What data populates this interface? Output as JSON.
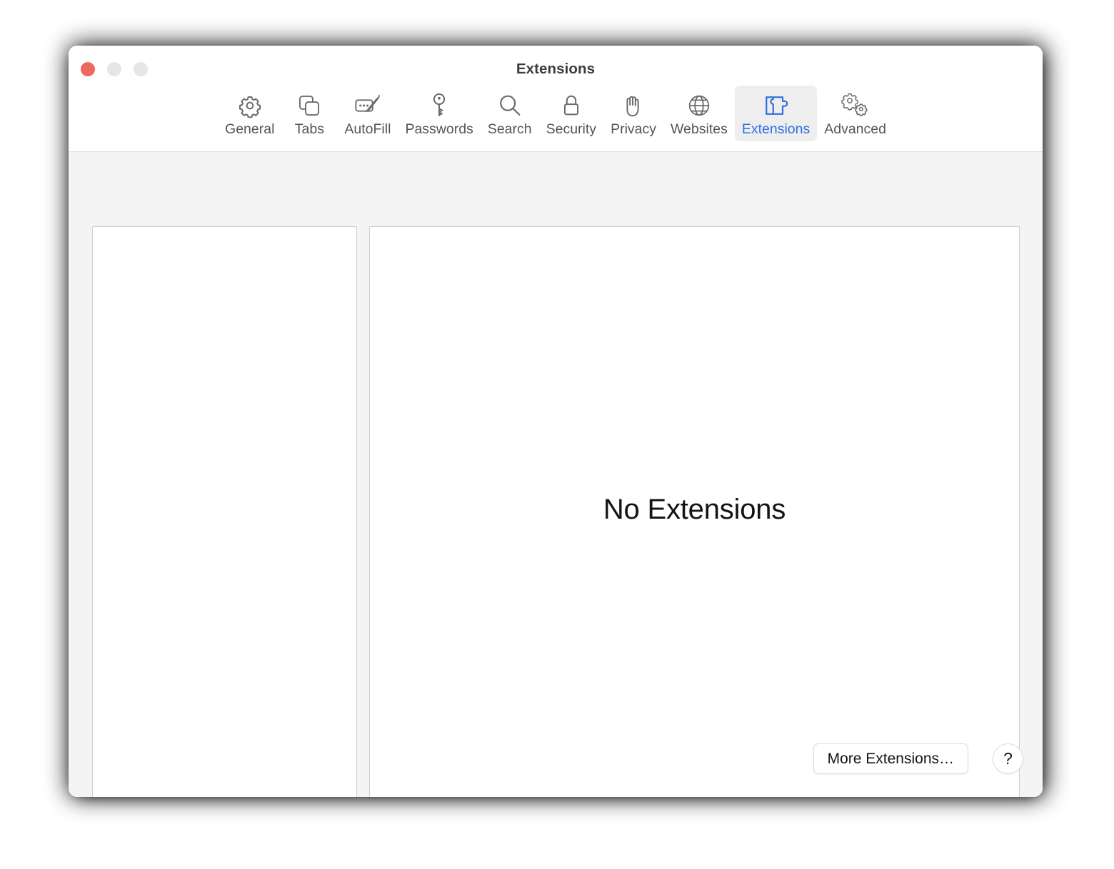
{
  "window": {
    "title": "Extensions",
    "traffic_lights": [
      {
        "name": "close",
        "color": "#ec6a5e"
      },
      {
        "name": "minimize",
        "color": "#e6e6e6"
      },
      {
        "name": "zoom",
        "color": "#e6e6e6"
      }
    ]
  },
  "toolbar": {
    "selected": "Extensions",
    "accent_color": "#2f6fe4",
    "label_color": "#555555",
    "tabs": [
      {
        "label": "General",
        "icon": "gear-icon"
      },
      {
        "label": "Tabs",
        "icon": "tabs-icon"
      },
      {
        "label": "AutoFill",
        "icon": "autofill-pencil-icon"
      },
      {
        "label": "Passwords",
        "icon": "key-icon"
      },
      {
        "label": "Search",
        "icon": "magnifier-icon"
      },
      {
        "label": "Security",
        "icon": "padlock-icon"
      },
      {
        "label": "Privacy",
        "icon": "hand-icon"
      },
      {
        "label": "Websites",
        "icon": "globe-icon"
      },
      {
        "label": "Extensions",
        "icon": "puzzle-piece-icon"
      },
      {
        "label": "Advanced",
        "icon": "double-gear-icon"
      }
    ]
  },
  "main": {
    "empty_state_text": "No Extensions"
  },
  "footer": {
    "more_extensions_label": "More Extensions…",
    "help_label": "?"
  }
}
